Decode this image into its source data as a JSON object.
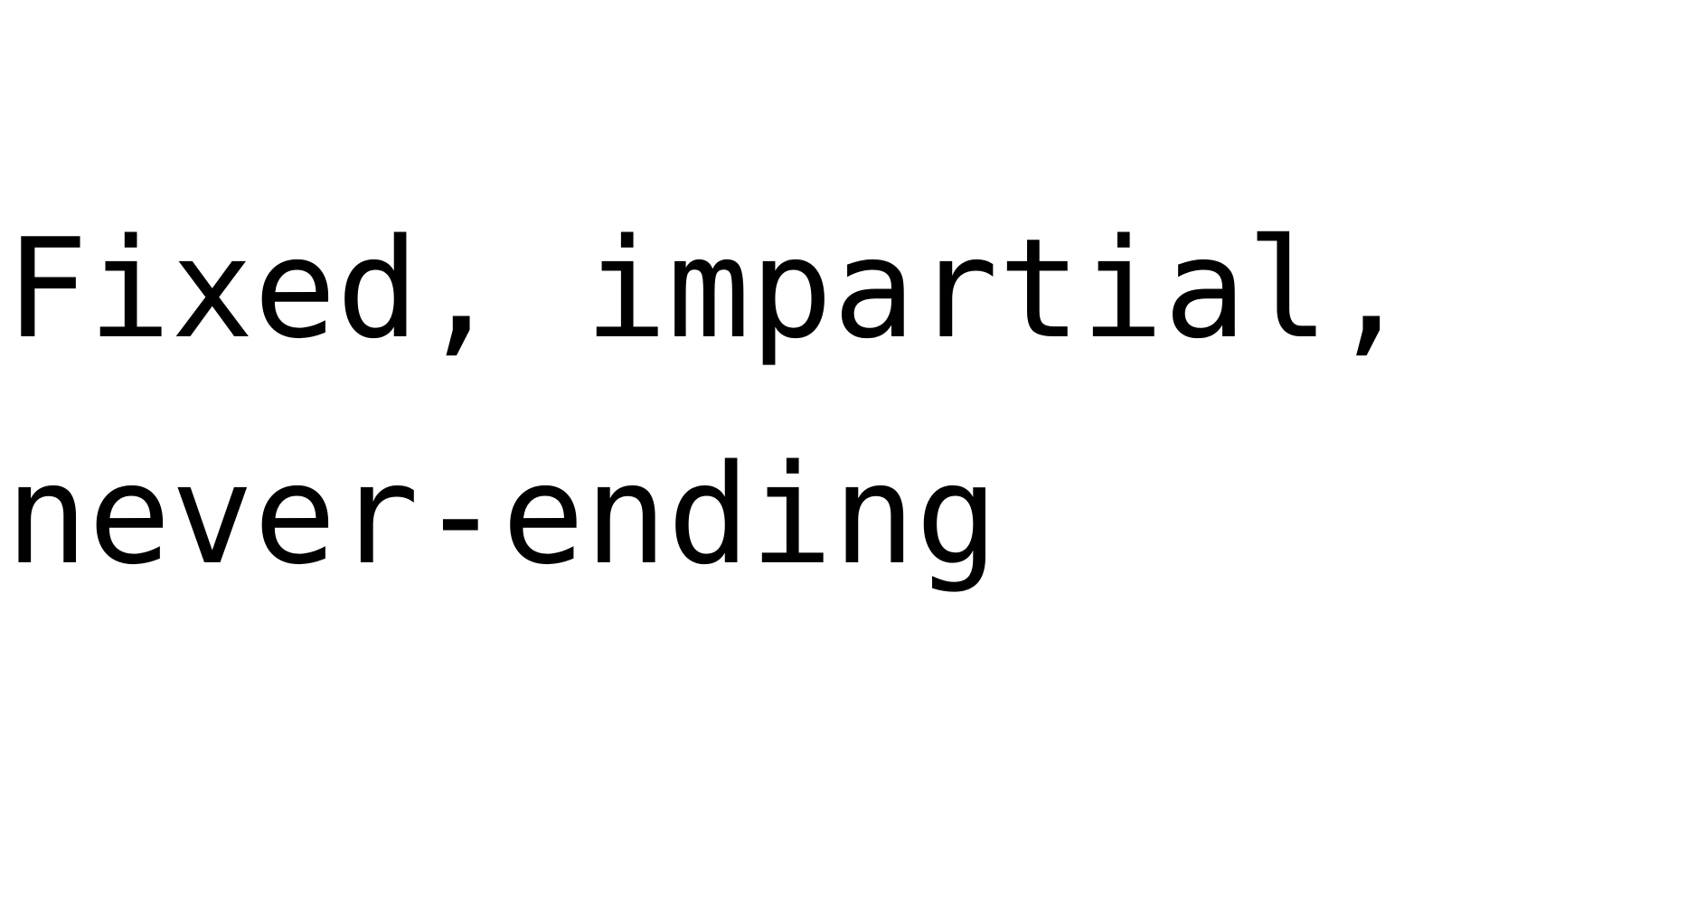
{
  "text": {
    "line1": "Fixed, impartial, ",
    "line2": "never-ending"
  },
  "colors": {
    "background": "#ffffff",
    "text": "#000000"
  }
}
